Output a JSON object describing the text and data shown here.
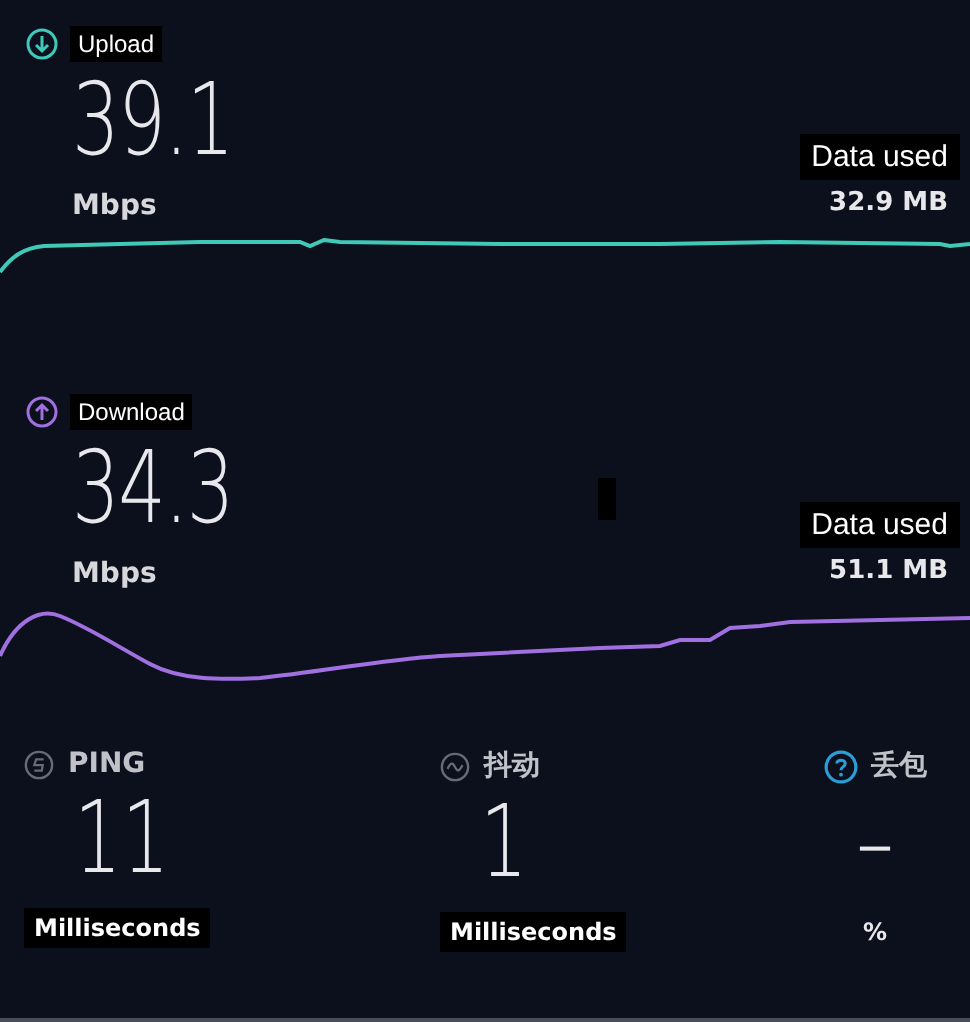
{
  "speeds": [
    {
      "label": "Upload",
      "value": "39.1",
      "unit": "Mbps",
      "data_label": "Data used",
      "data_value": "32.9 MB",
      "color": "#3fc9b8"
    },
    {
      "label": "Download",
      "value": "34.3",
      "unit": "Mbps",
      "data_label": "Data used",
      "data_value": "51.1 MB",
      "color": "#a070e0"
    }
  ],
  "stats": [
    {
      "label": "PING",
      "value": "11",
      "unit": "Milliseconds",
      "boxed": true
    },
    {
      "label": "抖动",
      "value": "1",
      "unit": "Milliseconds",
      "boxed": true
    },
    {
      "label": "丢包",
      "value": "–",
      "unit": "%",
      "boxed": false
    }
  ]
}
